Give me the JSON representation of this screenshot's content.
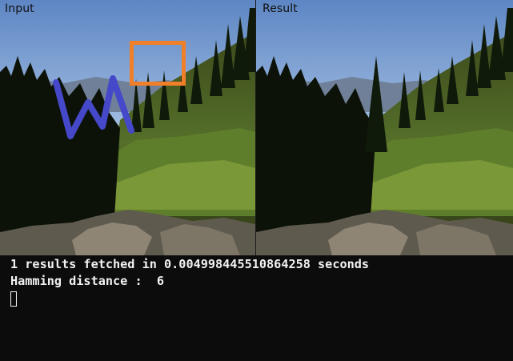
{
  "panels": {
    "input_label": "Input",
    "result_label": "Result"
  },
  "terminal": {
    "line1": "1 results fetched in 0.004998445510864258 seconds",
    "line2": "Hamming distance :  6"
  },
  "colors": {
    "terminal_bg": "#0c0c0c",
    "terminal_text": "#f2f2f2",
    "selection_box": "#f07f2a",
    "scribble": "#4548c8"
  }
}
